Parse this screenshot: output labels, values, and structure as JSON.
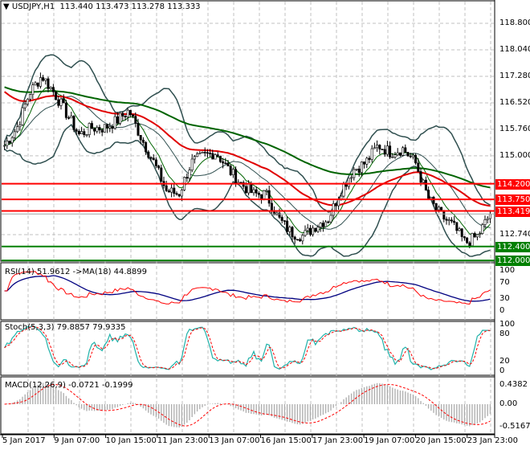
{
  "header": {
    "symbol": "USDJPY,H1",
    "open": "113.440",
    "high": "113.473",
    "low": "113.278",
    "close": "113.333"
  },
  "price_axis": [
    "118.800",
    "118.040",
    "117.280",
    "116.520",
    "115.760",
    "115.000",
    "112.740"
  ],
  "price_axis_values": [
    118.8,
    118.04,
    117.28,
    116.52,
    115.76,
    115.0,
    112.74
  ],
  "levels": [
    {
      "label": "114.200",
      "value": 114.2,
      "color": "#ff0000"
    },
    {
      "label": "113.750",
      "value": 113.75,
      "color": "#ff0000"
    },
    {
      "label": "113.419",
      "value": 113.419,
      "color": "#ff0000"
    },
    {
      "label": "112.400",
      "value": 112.4,
      "color": "#008000"
    },
    {
      "label": "112.000",
      "value": 112.0,
      "color": "#008000"
    }
  ],
  "rsi": {
    "title": "RSI(14) 51.9612  ->MA(18) 44.8899",
    "axis": [
      "100",
      "70",
      "30",
      "0"
    ]
  },
  "stoch": {
    "title": "Stoch(5,3,3) 79.8857 79.9335",
    "axis": [
      "100",
      "80",
      "20",
      "0"
    ]
  },
  "macd": {
    "title": "MACD(12,26,9) -0.0721 -0.1999",
    "axis": [
      "0.4382",
      "0.00",
      "-0.5167"
    ]
  },
  "time_axis": [
    "5 Jan 2017",
    "9 Jan 07:00",
    "10 Jan 15:00",
    "11 Jan 23:00",
    "13 Jan 07:00",
    "16 Jan 15:00",
    "17 Jan 23:00",
    "19 Jan 07:00",
    "20 Jan 15:00",
    "23 Jan 23:00"
  ],
  "chart_data": {
    "type": "candlestick",
    "symbol": "USDJPY",
    "timeframe": "H1",
    "close_path": [
      115.3,
      115.8,
      116.8,
      117.3,
      116.8,
      116.2,
      115.6,
      115.8,
      115.8,
      116.0,
      116.3,
      115.5,
      114.8,
      114.0,
      113.9,
      114.8,
      115.0,
      115.1,
      114.6,
      114.2,
      113.9,
      113.9,
      113.2,
      112.8,
      112.7,
      113.0,
      113.2,
      114.0,
      114.6,
      114.8,
      115.3,
      115.1,
      115.2,
      114.8,
      113.8,
      113.3,
      113.0,
      112.5,
      112.7,
      113.33
    ],
    "ylim": [
      111.95,
      119.3
    ]
  }
}
